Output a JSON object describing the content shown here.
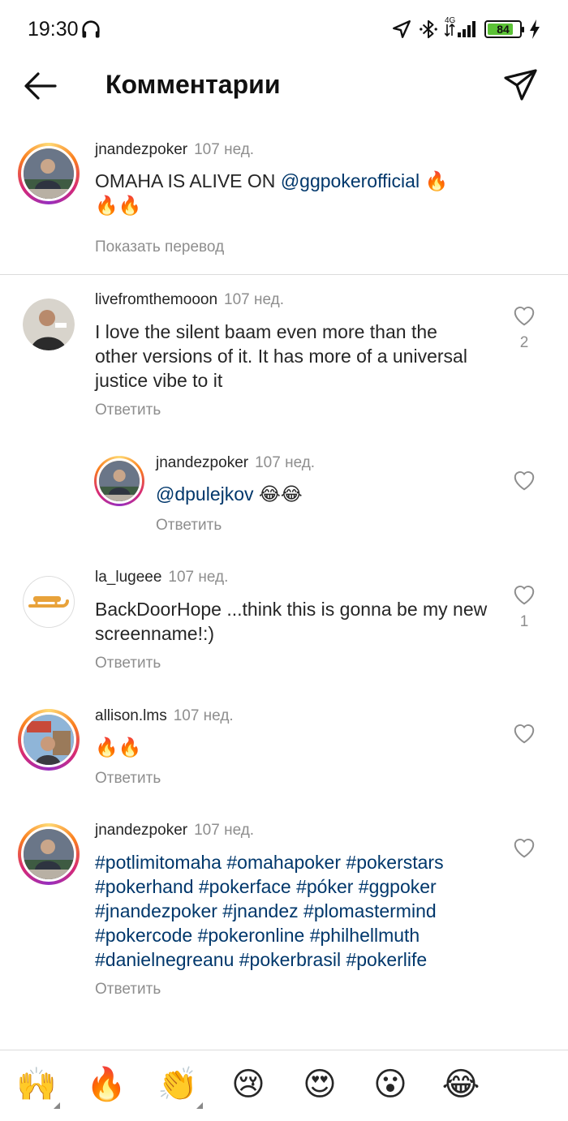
{
  "status_bar": {
    "time": "19:30",
    "network": "4G",
    "battery": 84,
    "battery_text": "84"
  },
  "header": {
    "title": "Комментарии"
  },
  "caption": {
    "username": "jnandezpoker",
    "time": "107 нед.",
    "text_before": "OMAHA IS ALIVE ON ",
    "mention": "@ggpokerofficial",
    "emoji_line1": "🔥",
    "emoji_line2": "🔥🔥",
    "translate_label": "Показать перевод"
  },
  "comments": [
    {
      "username": "livefromthemooon",
      "time": "107 нед.",
      "text": "I love the silent baam even more than the other versions of it. It has more of a universal justice vibe to it",
      "reply_label": "Ответить",
      "likes": "2"
    },
    {
      "username": "jnandezpoker",
      "time": "107 нед.",
      "mention": "@dpulejkov",
      "emoji": "😂😂",
      "reply_label": "Ответить"
    },
    {
      "username": "la_lugeee",
      "time": "107 нед.",
      "text": "BackDoorHope ...think this is gonna be my new screenname!:)",
      "reply_label": "Ответить",
      "likes": "1"
    },
    {
      "username": "allison.lms",
      "time": "107 нед.",
      "text": "🔥🔥",
      "reply_label": "Ответить"
    },
    {
      "username": "jnandezpoker",
      "time": "107 нед.",
      "hashtags": [
        "#potlimitomaha #omahapoker #pokerstars",
        "#pokerhand #pokerface #póker #ggpoker",
        "#jnandezpoker #jnandez #plomastermind",
        "#pokercode #pokeronline #philhellmuth",
        "#danielnegreanu #pokerbrasil #pokerlife"
      ],
      "reply_label": "Ответить"
    }
  ],
  "emoji_bar": [
    "🙌",
    "🔥",
    "👏",
    "😢",
    "😍",
    "😮",
    "😂"
  ]
}
